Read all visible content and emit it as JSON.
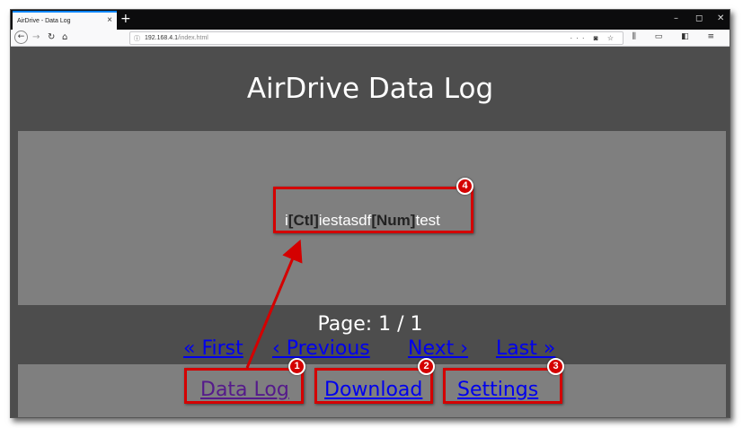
{
  "browser": {
    "tab_title": "AirDrive - Data Log",
    "tab_close": "×",
    "new_tab": "+",
    "minimize": "–",
    "restore": "◻",
    "close": "✕",
    "url_host": "192.168.4.1",
    "url_path": "/index.html",
    "page_actions": "··· ◙ ☆",
    "toolbar_icons": "⫼ ▭ ◧ ≡"
  },
  "page": {
    "title": "AirDrive Data Log",
    "log": {
      "seg1": "i",
      "tag1": "[Ctl]",
      "seg2": "iestasdf",
      "tag2": "[Num]",
      "seg3": "test"
    },
    "page_label": "Page: 1 / 1",
    "pager": {
      "first": "« First",
      "previous": "‹ Previous",
      "next": "Next ›",
      "last": "Last »"
    },
    "menu": {
      "data_log": "Data Log",
      "download": "Download",
      "settings": "Settings"
    }
  },
  "annotations": {
    "badges": [
      "1",
      "2",
      "3",
      "4"
    ],
    "color": "#d40000"
  }
}
